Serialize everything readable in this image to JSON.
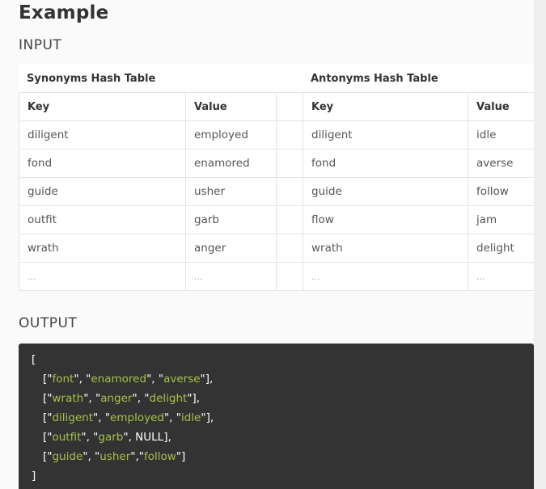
{
  "title": "Example",
  "input_heading": "INPUT",
  "output_heading": "OUTPUT",
  "tables": {
    "synonyms_caption": "Synonyms Hash Table",
    "antonyms_caption": "Antonyms Hash Table",
    "headers": {
      "syn_key": "Key",
      "syn_value": "Value",
      "ant_key": "Key",
      "ant_value": "Value"
    },
    "rows": [
      {
        "syn_key": "diligent",
        "syn_value": "employed",
        "ant_key": "diligent",
        "ant_value": "idle"
      },
      {
        "syn_key": "fond",
        "syn_value": "enamored",
        "ant_key": "fond",
        "ant_value": "averse"
      },
      {
        "syn_key": "guide",
        "syn_value": "usher",
        "ant_key": "guide",
        "ant_value": "follow"
      },
      {
        "syn_key": "outfit",
        "syn_value": "garb",
        "ant_key": "flow",
        "ant_value": "jam"
      },
      {
        "syn_key": "wrath",
        "syn_value": "anger",
        "ant_key": "wrath",
        "ant_value": "delight"
      },
      {
        "syn_key": "...",
        "syn_value": "...",
        "ant_key": "...",
        "ant_value": "..."
      }
    ]
  },
  "output": {
    "open_bracket": "[",
    "close_bracket": "]",
    "lines": [
      {
        "a": "font",
        "b": "enamored",
        "c": "averse",
        "c_is_null": false,
        "sep_c": ", "
      },
      {
        "a": "wrath",
        "b": "anger",
        "c": "delight",
        "c_is_null": false,
        "sep_c": ", "
      },
      {
        "a": "diligent",
        "b": "employed",
        "c": "idle",
        "c_is_null": false,
        "sep_c": ", "
      },
      {
        "a": "outfit",
        "b": "garb",
        "c": "NULL",
        "c_is_null": true,
        "sep_c": ", "
      },
      {
        "a": "guide",
        "b": "usher",
        "c": "follow",
        "c_is_null": false,
        "sep_c": ","
      }
    ]
  },
  "colors": {
    "code_background": "#333333",
    "code_string": "#a6c24a",
    "code_text": "#ffffff"
  }
}
